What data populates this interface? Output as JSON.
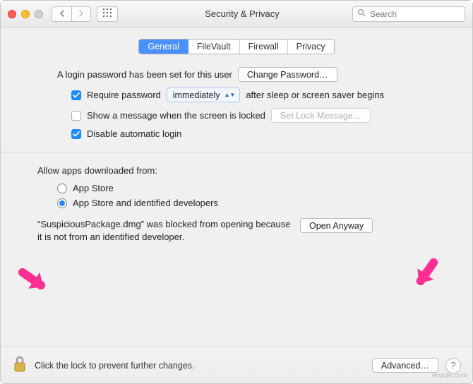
{
  "window": {
    "title": "Security & Privacy",
    "search_placeholder": "Search"
  },
  "tabs": {
    "general": "General",
    "filevault": "FileVault",
    "firewall": "Firewall",
    "privacy": "Privacy"
  },
  "general": {
    "login_set_text": "A login password has been set for this user",
    "change_password_btn": "Change Password…",
    "require_password_label": "Require password",
    "require_password_popup": "immediately",
    "require_password_after": "after sleep or screen saver begins",
    "show_message_label": "Show a message when the screen is locked",
    "set_lock_message_btn": "Set Lock Message…",
    "disable_auto_login_label": "Disable automatic login"
  },
  "gatekeeper": {
    "heading": "Allow apps downloaded from:",
    "radio_appstore": "App Store",
    "radio_identified": "App Store and identified developers",
    "blocked_text": "“SuspiciousPackage.dmg” was blocked from opening because it is not from an identified developer.",
    "open_anyway_btn": "Open Anyway"
  },
  "footer": {
    "lock_text": "Click the lock to prevent further changes.",
    "advanced_btn": "Advanced…"
  },
  "watermark": "wsxdn.com",
  "colors": {
    "accent": "#1e88ff",
    "arrow": "#ff2f92"
  }
}
